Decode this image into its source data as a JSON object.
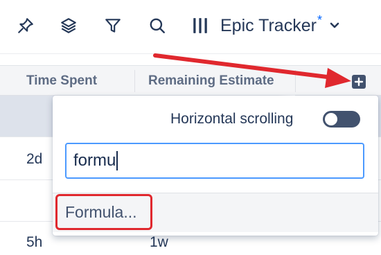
{
  "toolbar": {
    "icons": [
      "pin-icon",
      "layers-icon",
      "filter-icon",
      "search-icon",
      "columns-icon"
    ],
    "view_name": "Epic Tracker",
    "unsaved_marker": "*"
  },
  "header": {
    "columns": [
      {
        "label": "Time Spent"
      },
      {
        "label": "Remaining Estimate"
      }
    ]
  },
  "rows": [
    {
      "time_spent": "",
      "remaining": ""
    },
    {
      "time_spent": "2d",
      "remaining": ""
    },
    {
      "time_spent": "",
      "remaining": ""
    },
    {
      "time_spent": "",
      "remaining": ""
    },
    {
      "time_spent": "5h",
      "remaining": "1w"
    }
  ],
  "popup": {
    "horizontal_scrolling_label": "Horizontal scrolling",
    "horizontal_scrolling_enabled": false,
    "search_value": "formu",
    "options": [
      {
        "label": "Formula..."
      }
    ]
  },
  "colors": {
    "annotation": "#e0282e",
    "focus_border": "#4c9aff",
    "accent": "#0065ff"
  }
}
